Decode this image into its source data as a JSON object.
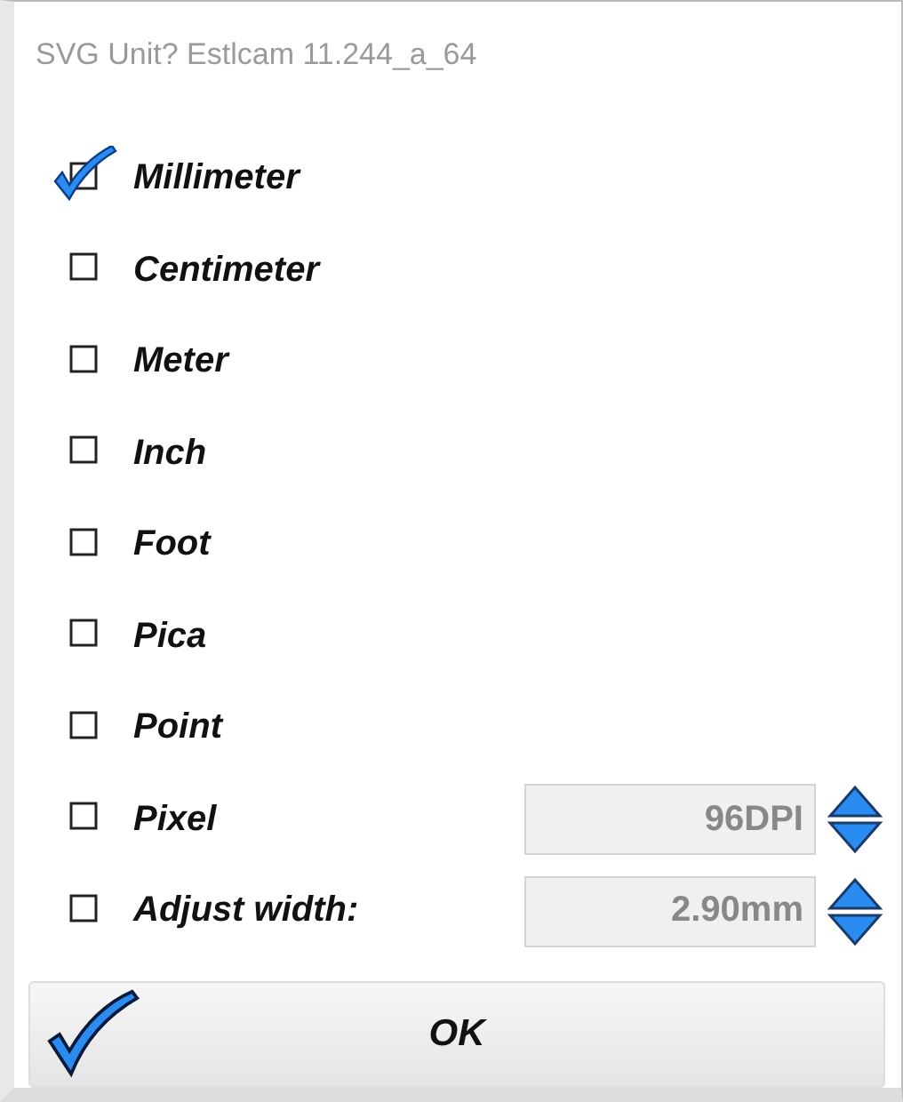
{
  "window": {
    "title": "SVG Unit? Estlcam 11.244_a_64"
  },
  "options": [
    {
      "kind": "plain",
      "label": "Millimeter",
      "checked": true
    },
    {
      "kind": "plain",
      "label": "Centimeter",
      "checked": false
    },
    {
      "kind": "plain",
      "label": "Meter",
      "checked": false
    },
    {
      "kind": "plain",
      "label": "Inch",
      "checked": false
    },
    {
      "kind": "plain",
      "label": "Foot",
      "checked": false
    },
    {
      "kind": "plain",
      "label": "Pica",
      "checked": false
    },
    {
      "kind": "plain",
      "label": "Point",
      "checked": false
    },
    {
      "kind": "field",
      "label": "Pixel",
      "checked": false,
      "value": "96DPI"
    },
    {
      "kind": "field",
      "label": "Adjust width:",
      "checked": false,
      "value": "2.90mm"
    }
  ],
  "ok_button": {
    "label": "OK"
  }
}
